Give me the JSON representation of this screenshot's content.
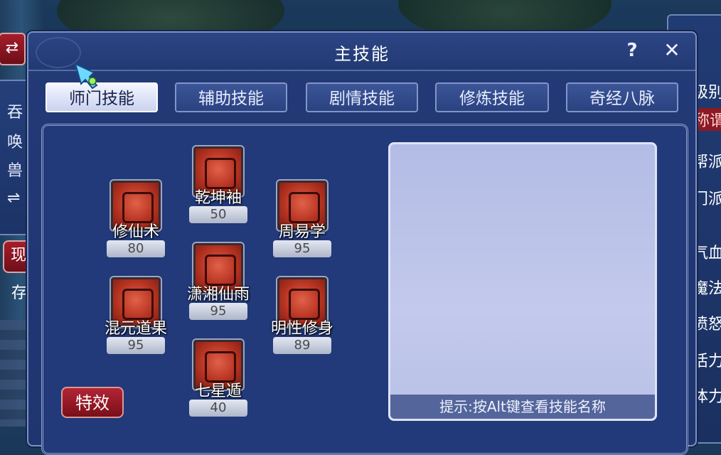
{
  "window": {
    "title": "主技能",
    "help_label": "?",
    "close_label": "✕"
  },
  "tabs": [
    {
      "label": "师门技能",
      "active": true
    },
    {
      "label": "辅助技能",
      "active": false
    },
    {
      "label": "剧情技能",
      "active": false
    },
    {
      "label": "修炼技能",
      "active": false
    },
    {
      "label": "奇经八脉",
      "active": false
    }
  ],
  "skills": [
    {
      "name": "乾坤袖",
      "level": "50"
    },
    {
      "name": "修仙术",
      "level": "80"
    },
    {
      "name": "周易学",
      "level": "95"
    },
    {
      "name": "潇湘仙雨",
      "level": "95"
    },
    {
      "name": "混元道果",
      "level": "95"
    },
    {
      "name": "明性修身",
      "level": "89"
    },
    {
      "name": "七星遁",
      "level": "40"
    }
  ],
  "effect_button": "特效",
  "hint": "提示:按Alt键查看技能名称",
  "left_panel": {
    "vertical_text": [
      "吞",
      "唤",
      "兽"
    ],
    "swap_icon": "⇄",
    "swap_icon2": "⇌",
    "red_button": "现",
    "side_text": "存"
  },
  "right_panel": {
    "items": [
      "级别",
      "称谓",
      "帮派",
      "门派",
      "气血",
      "魔法",
      "愤怒",
      "活力",
      "体力"
    ]
  }
}
